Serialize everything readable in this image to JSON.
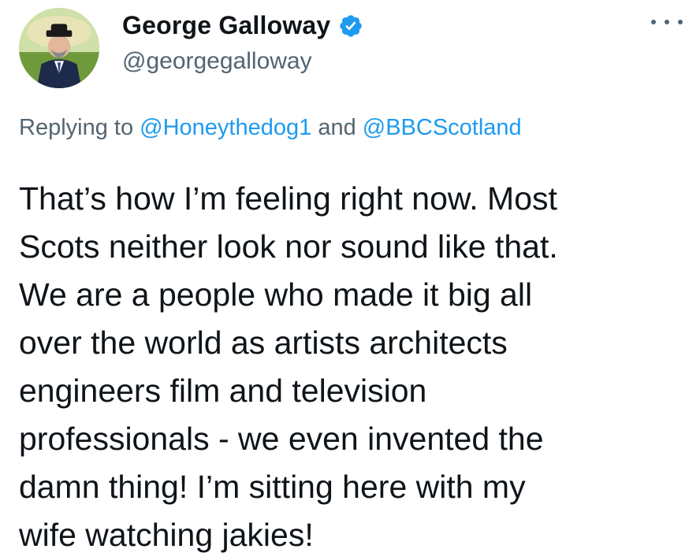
{
  "author": {
    "display_name": "George Galloway",
    "handle": "@georgegalloway",
    "verified": true
  },
  "reply": {
    "prefix": "Replying to ",
    "mention1": "@Honeythedog1",
    "joiner": " and ",
    "mention2": "@BBCScotland"
  },
  "tweet": {
    "lines": [
      "That’s how I’m feeling right now. Most",
      "Scots neither look nor sound like that.",
      "We are a people who made it big all",
      "over the world as artists architects",
      "engineers film and television",
      "professionals - we even invented the",
      "damn thing! I’m sitting here with my",
      "wife watching jakies!"
    ]
  },
  "colors": {
    "text": "#0f1419",
    "secondary": "#536471",
    "link": "#1d9bf0"
  },
  "icons": {
    "verified": "verified-badge-icon",
    "more": "more-horizontal-icon"
  }
}
